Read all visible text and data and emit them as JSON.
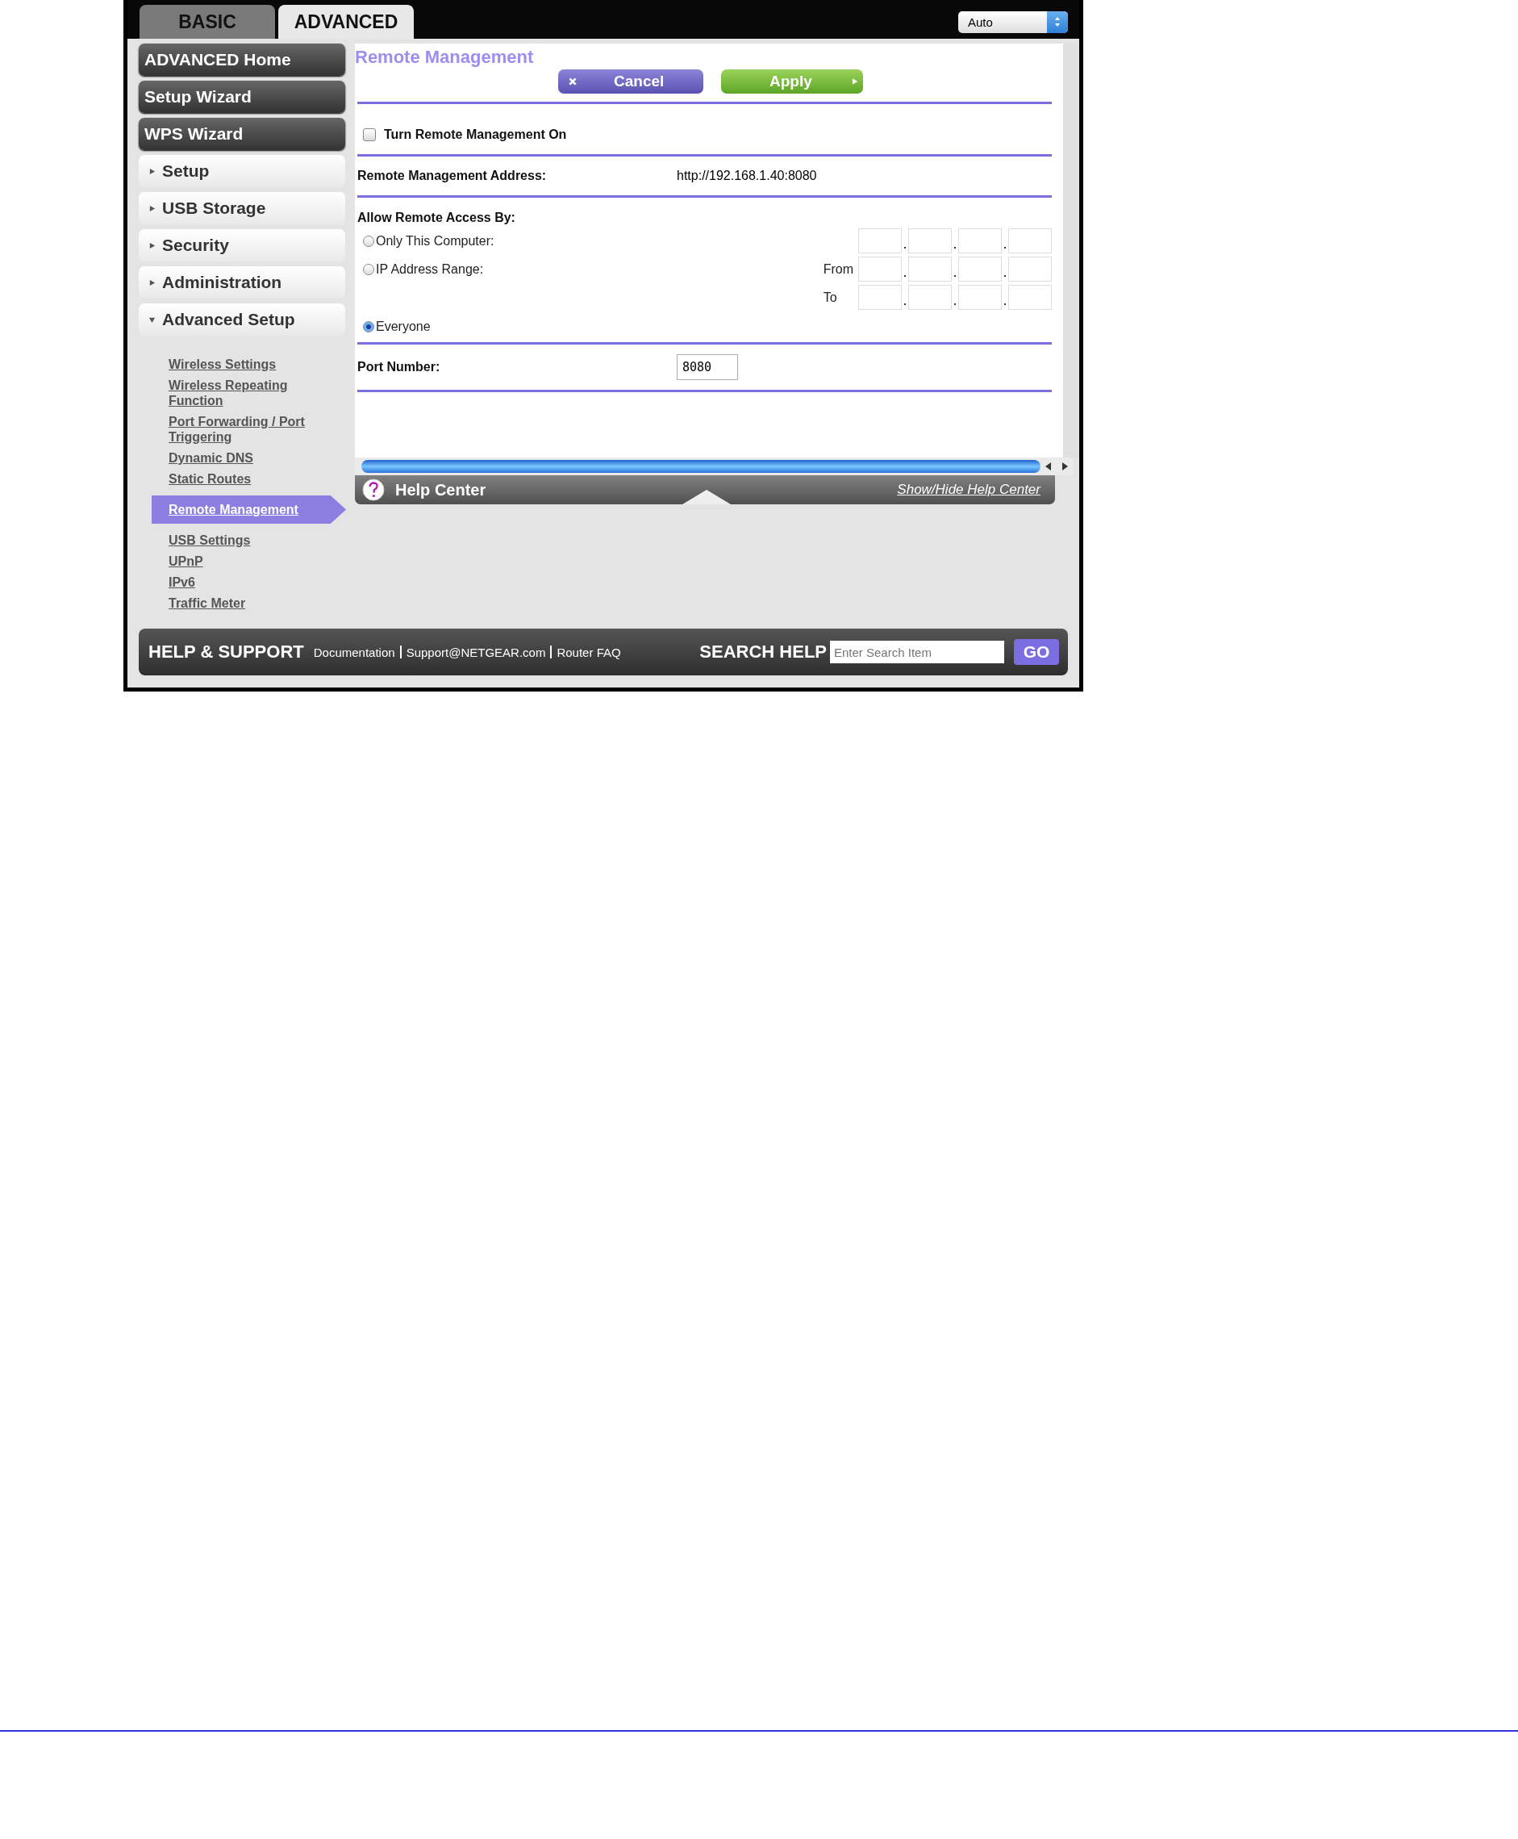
{
  "tabs": [
    {
      "label": "BASIC",
      "selected": false
    },
    {
      "label": "ADVANCED",
      "selected": true
    }
  ],
  "language_select": {
    "value": "Auto"
  },
  "sidebar": {
    "buttons": [
      "ADVANCED Home",
      "Setup Wizard",
      "WPS Wizard"
    ],
    "sections": [
      {
        "label": "Setup",
        "expanded": false
      },
      {
        "label": "USB Storage",
        "expanded": false
      },
      {
        "label": "Security",
        "expanded": false
      },
      {
        "label": "Administration",
        "expanded": false
      },
      {
        "label": "Advanced Setup",
        "expanded": true
      }
    ],
    "links": [
      {
        "label": "Wireless Settings",
        "selected": false
      },
      {
        "label": "Wireless Repeating Function",
        "selected": false
      },
      {
        "label": "Port Forwarding / Port Triggering",
        "selected": false
      },
      {
        "label": "Dynamic DNS",
        "selected": false
      },
      {
        "label": "Static Routes",
        "selected": false
      },
      {
        "label": "Remote Management",
        "selected": true
      },
      {
        "label": "USB Settings",
        "selected": false
      },
      {
        "label": "UPnP",
        "selected": false
      },
      {
        "label": "IPv6",
        "selected": false
      },
      {
        "label": "Traffic Meter",
        "selected": false
      }
    ]
  },
  "page": {
    "title": "Remote Management",
    "buttons": [
      {
        "label": "Cancel",
        "kind": "cancel"
      },
      {
        "label": "Apply",
        "kind": "apply"
      }
    ],
    "remote_on": {
      "label": "Turn Remote Management On",
      "checked": false
    },
    "address": {
      "label": "Remote Management Address:",
      "value": "http://192.168.1.40:8080"
    },
    "access": {
      "label": "Allow Remote Access By:",
      "options": [
        {
          "label": "Only This Computer:",
          "selected": false
        },
        {
          "label": "IP Address Range:",
          "selected": false
        },
        {
          "label": "Everyone",
          "selected": true
        }
      ],
      "range_labels": [
        "From",
        "To"
      ]
    },
    "port": {
      "label": "Port Number:",
      "value": "8080"
    }
  },
  "help_center": {
    "title": "Help Center",
    "toggle": "Show/Hide Help Center"
  },
  "footer": {
    "title": "HELP & SUPPORT",
    "links": [
      "Documentation",
      "Support@NETGEAR.com",
      "Router FAQ"
    ],
    "search_label": "SEARCH HELP",
    "search": {
      "placeholder": "Enter Search Item"
    },
    "go": "GO"
  }
}
